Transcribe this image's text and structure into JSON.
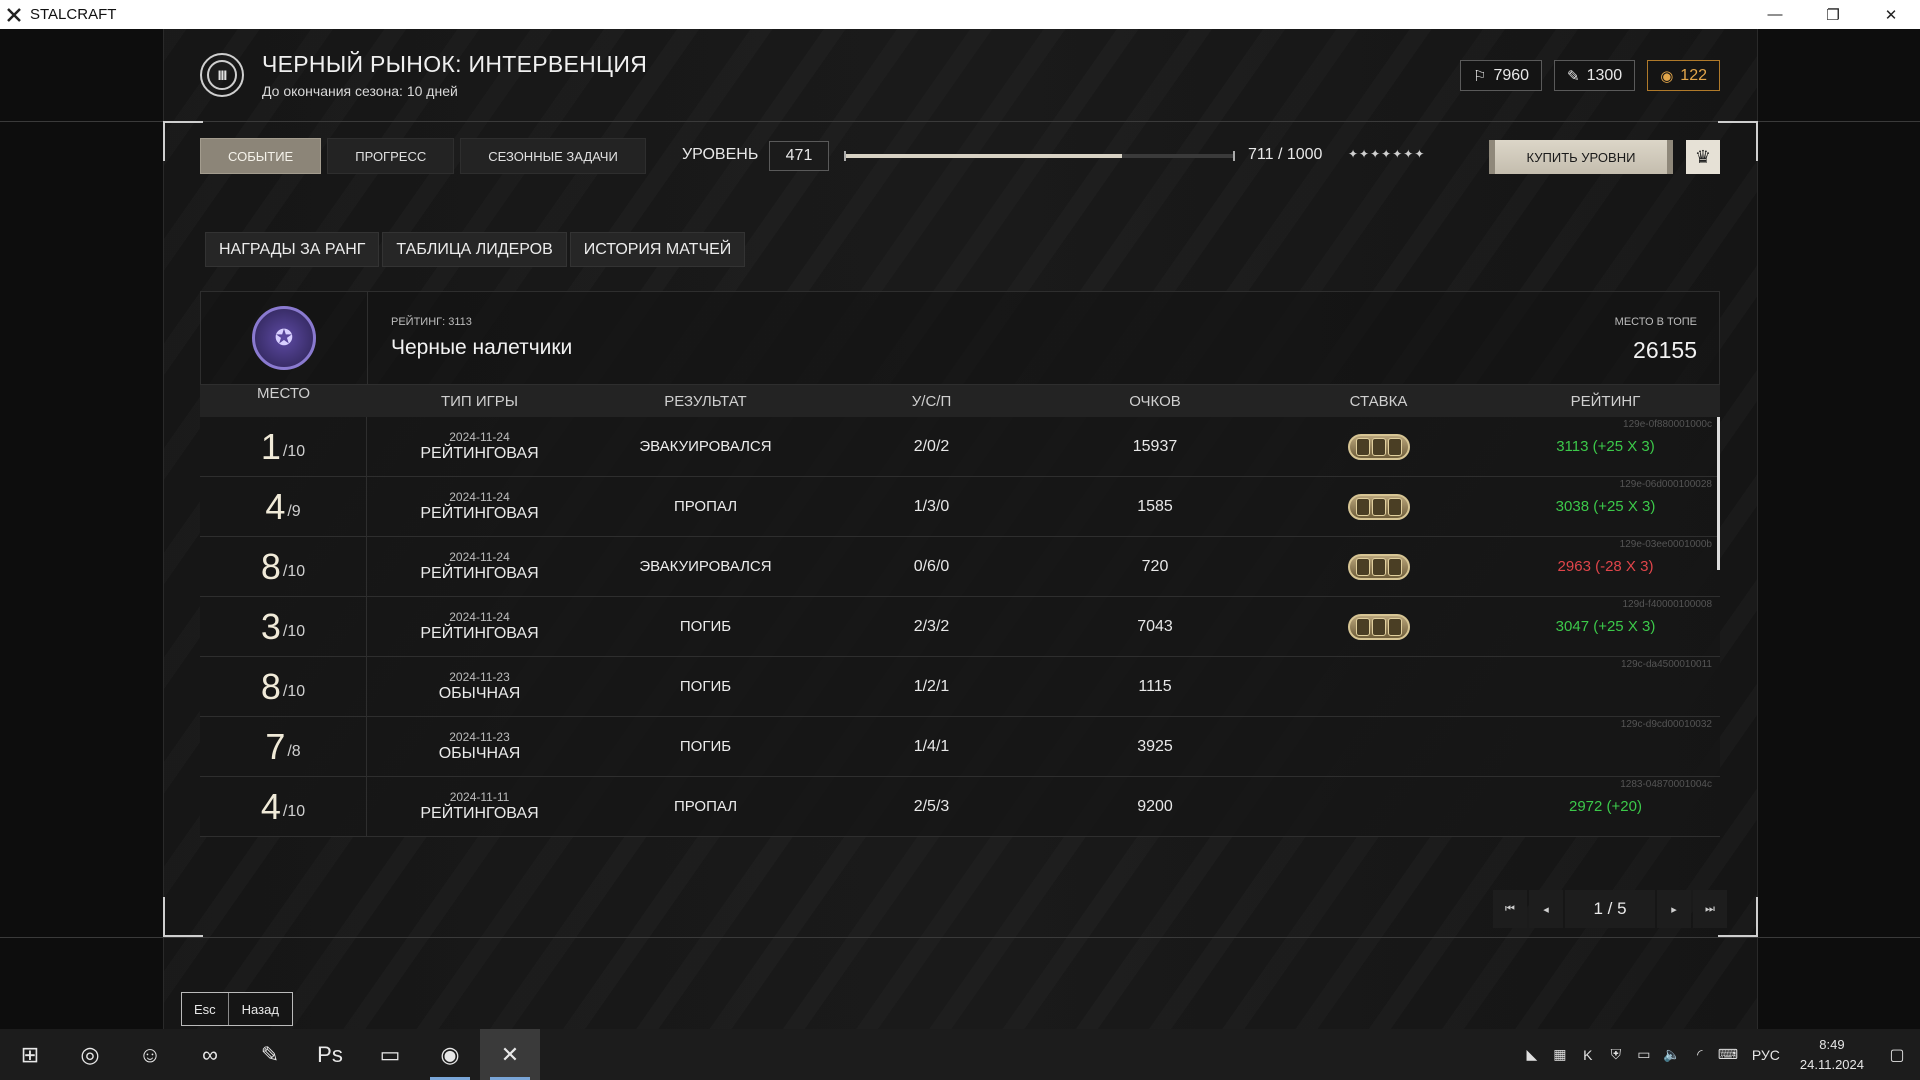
{
  "window": {
    "title": "STALCRAFT",
    "controls": [
      "—",
      "❐",
      "✕"
    ]
  },
  "header": {
    "title": "ЧЕРНЫЙ РЫНОК: ИНТЕРВЕНЦИЯ",
    "subtitle": "До окончания сезона: 10 дней",
    "emblem_icon": "III"
  },
  "currencies": [
    {
      "name": "trophy-currency-icon",
      "icon": "⚐",
      "value": "7960"
    },
    {
      "name": "ticket-currency-icon",
      "icon": "✎",
      "value": "1300"
    },
    {
      "name": "coin-currency-icon",
      "icon": "◉",
      "value": "122"
    }
  ],
  "tabs": [
    {
      "label": "СОБЫТИЕ",
      "active": true
    },
    {
      "label": "ПРОГРЕСС",
      "active": false
    },
    {
      "label": "СЕЗОННЫЕ ЗАДАЧИ",
      "active": false
    }
  ],
  "level": {
    "label": "УРОВЕНЬ",
    "value": "471",
    "progress_fraction": 0.711,
    "progress_text": "711 / 1000",
    "stars": "✦✦✦✦✦✦✦",
    "buy_label": "КУПИТЬ УРОВНИ",
    "crown_icon": "♛"
  },
  "subtabs": [
    "НАГРАДЫ ЗА РАНГ",
    "ТАБЛИЦА ЛИДЕРОВ",
    "ИСТОРИЯ МАТЧЕЙ"
  ],
  "clan": {
    "rating_label": "РЕЙТИНГ: 3113",
    "name": "Черные налетчики",
    "top_label": "МЕСТО В ТОПЕ",
    "top_value": "26155",
    "emblem_icon": "✪"
  },
  "table": {
    "headers": [
      "МЕСТО",
      "ТИП ИГРЫ",
      "РЕЗУЛЬТАТ",
      "У/С/П",
      "ОЧКОВ",
      "СТАВКА",
      "РЕЙТИНГ"
    ],
    "rows": [
      {
        "place": "1",
        "of": "/10",
        "date": "2024-11-24",
        "type": "РЕЙТИНГОВАЯ",
        "result": "ЭВАКУИРОВАЛСЯ",
        "ucp": "2/0/2",
        "score": "15937",
        "bet": true,
        "rating": "3113 (+25 X 3)",
        "rating_sign": "pos",
        "id": "129e-0f880001000c"
      },
      {
        "place": "4",
        "of": "/9",
        "date": "2024-11-24",
        "type": "РЕЙТИНГОВАЯ",
        "result": "ПРОПАЛ",
        "ucp": "1/3/0",
        "score": "1585",
        "bet": true,
        "rating": "3038 (+25 X 3)",
        "rating_sign": "pos",
        "id": "129e-06d000100028"
      },
      {
        "place": "8",
        "of": "/10",
        "date": "2024-11-24",
        "type": "РЕЙТИНГОВАЯ",
        "result": "ЭВАКУИРОВАЛСЯ",
        "ucp": "0/6/0",
        "score": "720",
        "bet": true,
        "rating": "2963 (-28 X 3)",
        "rating_sign": "neg",
        "id": "129e-03ee0001000b"
      },
      {
        "place": "3",
        "of": "/10",
        "date": "2024-11-24",
        "type": "РЕЙТИНГОВАЯ",
        "result": "ПОГИБ",
        "ucp": "2/3/2",
        "score": "7043",
        "bet": true,
        "rating": "3047 (+25 X 3)",
        "rating_sign": "pos",
        "id": "129d-f40000100008"
      },
      {
        "place": "8",
        "of": "/10",
        "date": "2024-11-23",
        "type": "ОБЫЧНАЯ",
        "result": "ПОГИБ",
        "ucp": "1/2/1",
        "score": "1115",
        "bet": false,
        "rating": "",
        "rating_sign": "none",
        "id": "129c-da4500010011"
      },
      {
        "place": "7",
        "of": "/8",
        "date": "2024-11-23",
        "type": "ОБЫЧНАЯ",
        "result": "ПОГИБ",
        "ucp": "1/4/1",
        "score": "3925",
        "bet": false,
        "rating": "",
        "rating_sign": "none",
        "id": "129c-d9cd00010032"
      },
      {
        "place": "4",
        "of": "/10",
        "date": "2024-11-11",
        "type": "РЕЙТИНГОВАЯ",
        "result": "ПРОПАЛ",
        "ucp": "2/5/3",
        "score": "9200",
        "bet": false,
        "rating": "2972 (+20)",
        "rating_sign": "pos",
        "id": "1283-04870001004c"
      }
    ]
  },
  "pagination": {
    "text": "1 / 5",
    "first": "⏮",
    "prev": "◂",
    "next": "▸",
    "last": "⏭"
  },
  "esc": {
    "key": "Esc",
    "label": "Назад"
  },
  "taskbar": {
    "apps": [
      {
        "name": "windows-start-icon",
        "icon": "⊞"
      },
      {
        "name": "steam-icon",
        "icon": "◎"
      },
      {
        "name": "discord-icon",
        "icon": "☺"
      },
      {
        "name": "visual-studio-icon",
        "icon": "∞"
      },
      {
        "name": "notepad-plus-icon",
        "icon": "✎"
      },
      {
        "name": "photoshop-icon",
        "icon": "Ps"
      },
      {
        "name": "file-explorer-icon",
        "icon": "▭"
      },
      {
        "name": "chrome-icon",
        "icon": "◉"
      },
      {
        "name": "stalcraft-icon",
        "icon": "✕"
      }
    ],
    "tray_icons": [
      {
        "name": "nvidia-icon",
        "icon": "◣"
      },
      {
        "name": "minecraft-icon",
        "icon": "▦"
      },
      {
        "name": "kaspersky-icon",
        "icon": "K"
      },
      {
        "name": "shield-icon",
        "icon": "⛨"
      },
      {
        "name": "battery-icon",
        "icon": "▭"
      },
      {
        "name": "volume-icon",
        "icon": "🔈"
      },
      {
        "name": "network-icon",
        "icon": "◜"
      },
      {
        "name": "keyboard-icon",
        "icon": "⌨"
      }
    ],
    "lang": "РУС",
    "time": "8:49",
    "date": "24.11.2024",
    "notif_icon": "▢"
  }
}
